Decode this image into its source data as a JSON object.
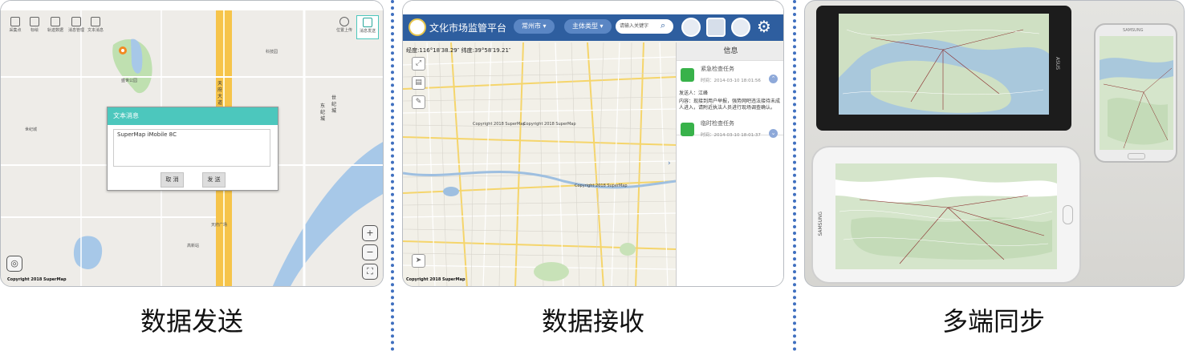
{
  "panels": [
    {
      "caption": "数据发送",
      "toolbar": [
        "采集点",
        "标绘",
        "轨迹数据",
        "消息管理",
        "文本消息"
      ],
      "right_tools": [
        "位置上传",
        "消息发送"
      ],
      "map_labels": [
        "天",
        "府",
        "大",
        "道",
        "世",
        "纪",
        "城",
        "东",
        "纪",
        "城",
        "世纪城",
        "天府广场",
        "高新站",
        "盛世公园",
        "科技园"
      ],
      "dialog": {
        "title": "文本消息",
        "text": "SuperMap iMobile 8C",
        "cancel_label": "取 消",
        "send_label": "发 送"
      },
      "copyright": "Copyright 2018 SuperMap"
    },
    {
      "caption": "数据接收",
      "app_title": "文化市场监管平台",
      "city_select": "常州市",
      "type_select": "主体类型",
      "search_placeholder": "请输入关键字",
      "coords": "经度:116°18′38.29″   纬度:39°58′19.21″",
      "info_title": "信息",
      "messages": [
        {
          "title": "紧急检查任务",
          "time": "时间：2014-03-10 18:01:56",
          "sender": "发送人：江峰",
          "content": "内容：现接到用户举报，强势网吧违法接待未成人进入，请附近执法人员进行现场调查确认。"
        },
        {
          "title": "临时检查任务",
          "time": "时间：2014-03-10 18:01:37"
        }
      ],
      "map_copyright_1": "Copyright 2018 SuperMap",
      "map_copyright_2": "Copyright 2018 SuperMap",
      "map_copyright_3": "Copyright 2018 SuperMap",
      "copyright": "Copyright 2018 SuperMap"
    },
    {
      "caption": "多端同步",
      "brand_1": "SAMSUNG",
      "brand_2": "SAMSUNG",
      "brand_3": "ASUS"
    }
  ]
}
